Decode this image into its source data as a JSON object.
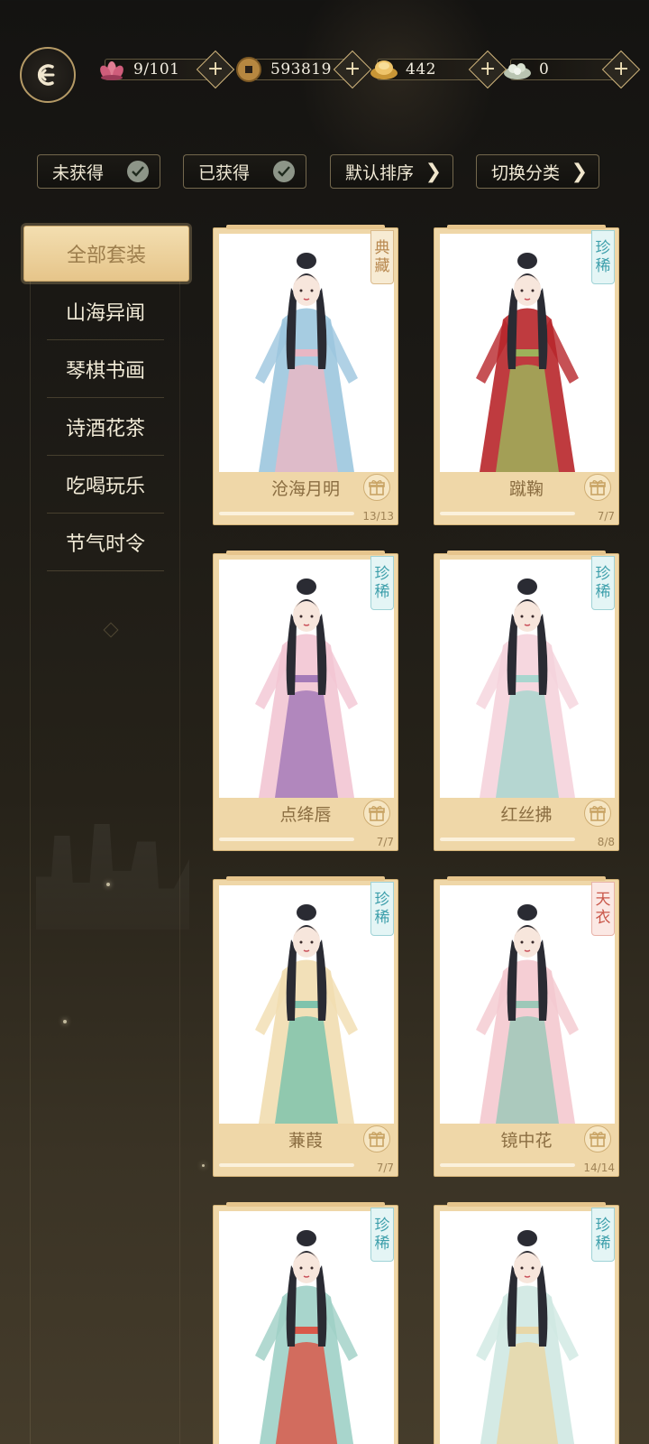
{
  "topbar": {
    "back_icon": "back-arrow-icon",
    "resources": [
      {
        "icon": "lotus-icon",
        "value": "9/101",
        "color": "#d9657e"
      },
      {
        "icon": "copper-coin-icon",
        "value": "593819",
        "color": "#b68740"
      },
      {
        "icon": "gold-ingot-icon",
        "value": "442",
        "color": "#e4b85a"
      },
      {
        "icon": "jade-icon",
        "value": "0",
        "color": "#cfd7c8"
      }
    ]
  },
  "filters": [
    {
      "label": "未获得",
      "icon": "check-icon"
    },
    {
      "label": "已获得",
      "icon": "check-icon"
    },
    {
      "label": "默认排序",
      "icon": "chevron-right-icon"
    },
    {
      "label": "切换分类",
      "icon": "chevron-right-icon"
    }
  ],
  "categories": {
    "active": "全部套装",
    "items": [
      "山海异闻",
      "琴棋书画",
      "诗酒花茶",
      "吃喝玩乐",
      "节气时令"
    ]
  },
  "cards": [
    {
      "name": "沧海月明",
      "tag": [
        "典",
        "藏"
      ],
      "tag_type": "collect",
      "progress": "13/13",
      "fill": 1.0,
      "palette": [
        "#9cc6de",
        "#e8b7c4",
        "#2a2b33"
      ]
    },
    {
      "name": "蹴鞠",
      "tag": [
        "珍",
        "稀"
      ],
      "tag_type": "rare",
      "progress": "7/7",
      "fill": 1.0,
      "palette": [
        "#b8262a",
        "#9db25a",
        "#2a2b33"
      ]
    },
    {
      "name": "点绛唇",
      "tag": [
        "珍",
        "稀"
      ],
      "tag_type": "rare",
      "progress": "7/7",
      "fill": 1.0,
      "palette": [
        "#f2c5d3",
        "#a47bb8",
        "#2a2b33"
      ]
    },
    {
      "name": "红丝拂",
      "tag": [
        "珍",
        "稀"
      ],
      "tag_type": "rare",
      "progress": "8/8",
      "fill": 1.0,
      "palette": [
        "#f5d3dc",
        "#a9d6cf",
        "#2a2b33"
      ]
    },
    {
      "name": "蒹葭",
      "tag": [
        "珍",
        "稀"
      ],
      "tag_type": "rare",
      "progress": "7/7",
      "fill": 1.0,
      "palette": [
        "#f1ddb0",
        "#7fc3ac",
        "#2a2b33"
      ]
    },
    {
      "name": "镜中花",
      "tag": [
        "天",
        "衣"
      ],
      "tag_type": "heaven",
      "progress": "14/14",
      "fill": 1.0,
      "palette": [
        "#f4c9cf",
        "#9dc8b8",
        "#2a2b33"
      ]
    },
    {
      "name": "",
      "tag": [
        "珍",
        "稀"
      ],
      "tag_type": "rare",
      "progress": "",
      "fill": 1.0,
      "palette": [
        "#9fd0c6",
        "#d9594a",
        "#2a2b33"
      ]
    },
    {
      "name": "",
      "tag": [
        "珍",
        "稀"
      ],
      "tag_type": "rare",
      "progress": "",
      "fill": 1.0,
      "palette": [
        "#cfe8e2",
        "#e8d7a8",
        "#2a2b33"
      ]
    }
  ]
}
